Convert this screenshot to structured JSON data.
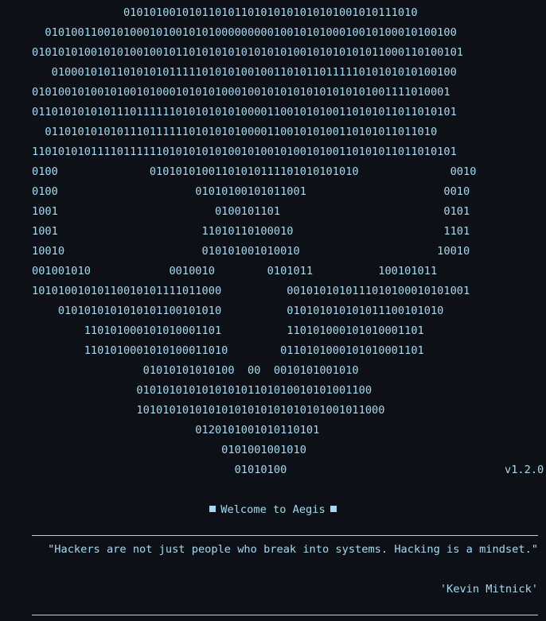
{
  "ascii_art": [
    "              01010100101011010110101010101010100101011101O",
    "  010100110010100010100101010000000001001010100010010100010100100",
    "0101010100101010010010110101010101010101001010101010110001101001O1",
    "   01000101011010101011111010101001001101011011111010101010100100",
    "0101001010010100101000101010100010010101010101010101001111010001",
    "01101010101011101111110101010101000011001010100110101011011010101",
    "  01101010101011101111110101010100001100101010011010101101101O",
    "11010101011110111111010101010100101001010010100110101011011010101",
    "0100              0101010100110101011110101010101O              0010",
    "0100                     0101010010101100I                     0010",
    "1001                        0100101101                         0101",
    "1001                      11010110100010                       1101",
    "10010                     010101001010010                     10010",
    "001001010            0010010        0101011          100101011",
    "1010100101011001010111101100O          001010101011101010001010100I",
    "    0101010101010101100101010          010101010101011100101010",
    "        1101010001010100011O1          11010100010101000110I",
    "        110101000101010001101O        01101010001010100011O1",
    "                 01010101010100  00  0010101001010",
    "                0101010101010101011010100101010011O0",
    "                10101010101010101010101010101001011000",
    "                         012010100101011010I",
    "                             0101001001010",
    "                               01010100"
  ],
  "version": "v1.2.0",
  "welcome": "Welcome to Aegis",
  "quote": "\"Hackers are not just people who break into systems. Hacking is a mindset.\"",
  "author": "'Kevin Mitnick'"
}
